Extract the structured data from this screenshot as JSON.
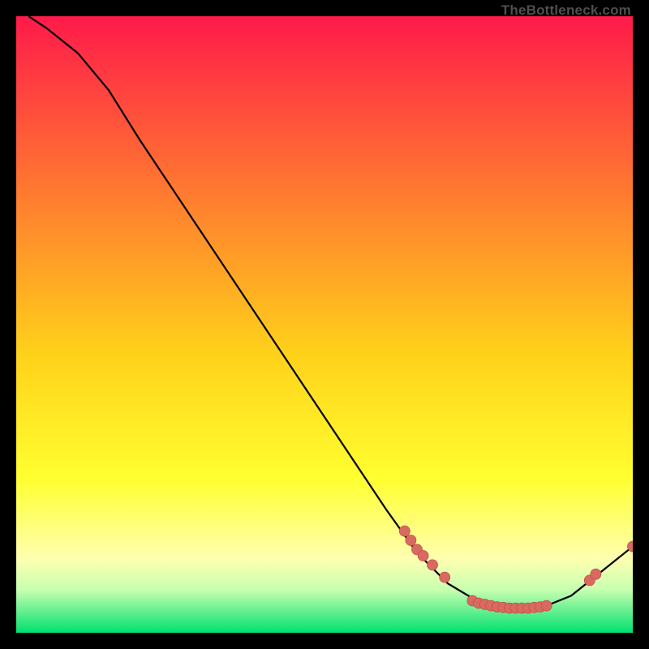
{
  "watermark": "TheBottleneck.com",
  "colors": {
    "bgTop": "#ff1a4a",
    "bgMidUpper": "#ff7830",
    "bgMid": "#ffd21a",
    "bgMidLower": "#ffff30",
    "bgLowerYellow": "#ffffb0",
    "bgGreenTop": "#c8ffb0",
    "bgGreenBottom": "#00e070",
    "curve": "#000000",
    "marker": "#d86a62",
    "markerEdge": "#c25048"
  },
  "chart_data": {
    "type": "line",
    "title": "",
    "xlabel": "",
    "ylabel": "",
    "xlim": [
      0,
      100
    ],
    "ylim": [
      0,
      100
    ],
    "grid": false,
    "legend": false,
    "curve": [
      {
        "x": 2,
        "y": 100
      },
      {
        "x": 5,
        "y": 98
      },
      {
        "x": 10,
        "y": 94
      },
      {
        "x": 15,
        "y": 88
      },
      {
        "x": 20,
        "y": 80
      },
      {
        "x": 30,
        "y": 65
      },
      {
        "x": 40,
        "y": 50
      },
      {
        "x": 50,
        "y": 35
      },
      {
        "x": 60,
        "y": 20
      },
      {
        "x": 65,
        "y": 13
      },
      {
        "x": 70,
        "y": 8
      },
      {
        "x": 75,
        "y": 5
      },
      {
        "x": 80,
        "y": 4
      },
      {
        "x": 85,
        "y": 4
      },
      {
        "x": 90,
        "y": 6
      },
      {
        "x": 95,
        "y": 10
      },
      {
        "x": 100,
        "y": 14
      }
    ],
    "markers": [
      {
        "x": 63,
        "y": 16.5
      },
      {
        "x": 64,
        "y": 15
      },
      {
        "x": 65,
        "y": 13.5
      },
      {
        "x": 66,
        "y": 12.5
      },
      {
        "x": 67.5,
        "y": 11
      },
      {
        "x": 69.5,
        "y": 9
      },
      {
        "x": 74,
        "y": 5.2
      },
      {
        "x": 75,
        "y": 4.8
      },
      {
        "x": 76,
        "y": 4.6
      },
      {
        "x": 77,
        "y": 4.4
      },
      {
        "x": 78,
        "y": 4.2
      },
      {
        "x": 79,
        "y": 4.1
      },
      {
        "x": 80,
        "y": 4.0
      },
      {
        "x": 81,
        "y": 4.0
      },
      {
        "x": 82,
        "y": 4.0
      },
      {
        "x": 83,
        "y": 4.0
      },
      {
        "x": 84,
        "y": 4.1
      },
      {
        "x": 85,
        "y": 4.2
      },
      {
        "x": 86,
        "y": 4.4
      },
      {
        "x": 93,
        "y": 8.5
      },
      {
        "x": 94,
        "y": 9.5
      },
      {
        "x": 100,
        "y": 14
      }
    ]
  }
}
